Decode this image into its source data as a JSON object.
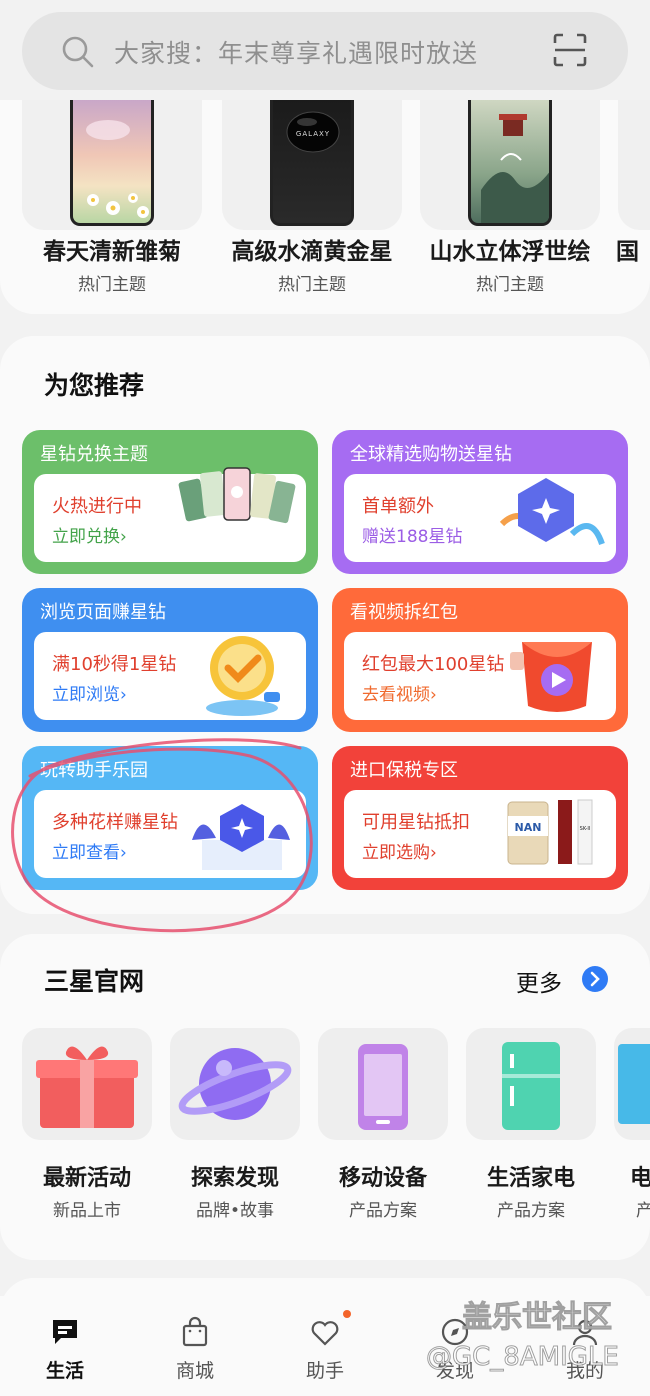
{
  "search": {
    "placeholder": "大家搜：年末尊享礼遇限时放送"
  },
  "themes": [
    {
      "name": "春天清新雏菊",
      "sub": "热门主题"
    },
    {
      "name": "高级水滴黄金星",
      "sub": "热门主题"
    },
    {
      "name": "山水立体浮世绘",
      "sub": "热门主题"
    },
    {
      "name": "国",
      "sub": ""
    }
  ],
  "recommend": {
    "title": "为您推荐",
    "promos": [
      {
        "head": "星钻兑换主题",
        "main": "火热进行中",
        "link": "立即兑换›",
        "color": "#6cbf6a"
      },
      {
        "head": "全球精选购物送星钻",
        "main": "首单额外",
        "link": "赠送188星钻",
        "color": "#a66cf2"
      },
      {
        "head": "浏览页面赚星钻",
        "main": "满10秒得1星钻",
        "link": "立即浏览›",
        "color": "#3f8ff0"
      },
      {
        "head": "看视频拆红包",
        "main": "红包最大100星钻",
        "link": "去看视频›",
        "color": "#ff6a3a"
      },
      {
        "head": "玩转助手乐园",
        "main": "多种花样赚星钻",
        "link": "立即查看›",
        "color": "#55b7f5"
      },
      {
        "head": "进口保税专区",
        "main": "可用星钻抵扣",
        "link": "立即选购›",
        "color": "#f2423a"
      }
    ],
    "nan_label": "NAN",
    "sk_label": "SK-II"
  },
  "samsung": {
    "title": "三星官网",
    "more": "更多",
    "items": [
      {
        "name": "最新活动",
        "sub": "新品上市"
      },
      {
        "name": "探索发现",
        "sub": "品牌•故事"
      },
      {
        "name": "移动设备",
        "sub": "产品方案"
      },
      {
        "name": "生活家电",
        "sub": "产品方案"
      },
      {
        "name": "电",
        "sub": "产"
      }
    ]
  },
  "tabs": [
    {
      "label": "生活"
    },
    {
      "label": "商城"
    },
    {
      "label": "助手"
    },
    {
      "label": "发现"
    },
    {
      "label": "我的"
    }
  ],
  "watermark": {
    "line1": "盖乐世社区",
    "line2": "@GC_8AMIGLE"
  },
  "colors": {
    "active_tab": "#111111",
    "badge_dot": "#f3642a",
    "more_button": "#2f7bf5",
    "annotation_circle": "#e6506e"
  }
}
